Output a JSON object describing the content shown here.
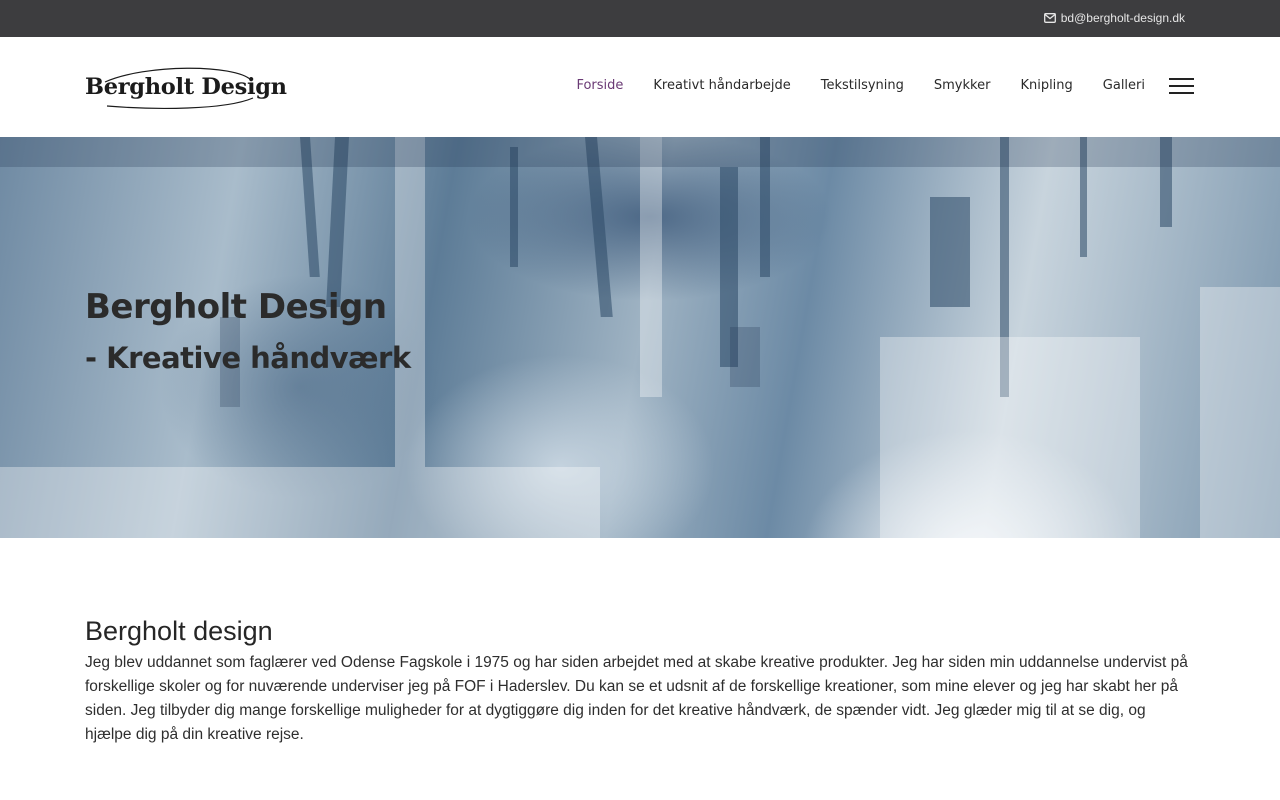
{
  "topbar": {
    "email": "bd@bergholt-design.dk",
    "icon": "envelope-icon"
  },
  "logo": {
    "text": "Bergholt Design"
  },
  "nav": {
    "items": [
      {
        "label": "Forside",
        "active": true
      },
      {
        "label": "Kreativt håndarbejde"
      },
      {
        "label": "Tekstilsyning"
      },
      {
        "label": "Smykker"
      },
      {
        "label": "Knipling"
      },
      {
        "label": "Galleri"
      }
    ],
    "menu_icon": "hamburger-menu-icon",
    "active_color": "#6a3a75"
  },
  "hero": {
    "title": "Bergholt Design",
    "subtitle": "- Kreative håndværk"
  },
  "intro": {
    "heading": "Bergholt design",
    "body": "Jeg blev uddannet som faglærer ved Odense Fagskole i 1975 og har siden arbejdet med at skabe kreative produkter. Jeg har siden min uddannelse undervist på forskellige skoler og for nuværende underviser jeg på FOF i Haderslev. Du kan se et udsnit af de forskellige kreationer, som mine elever og jeg har skabt her på siden. Jeg tilbyder dig mange forskellige muligheder for at dygtiggøre dig inden for det kreative håndværk, de spænder vidt. Jeg glæder mig til at se dig, og hjælpe dig på din kreative rejse."
  }
}
